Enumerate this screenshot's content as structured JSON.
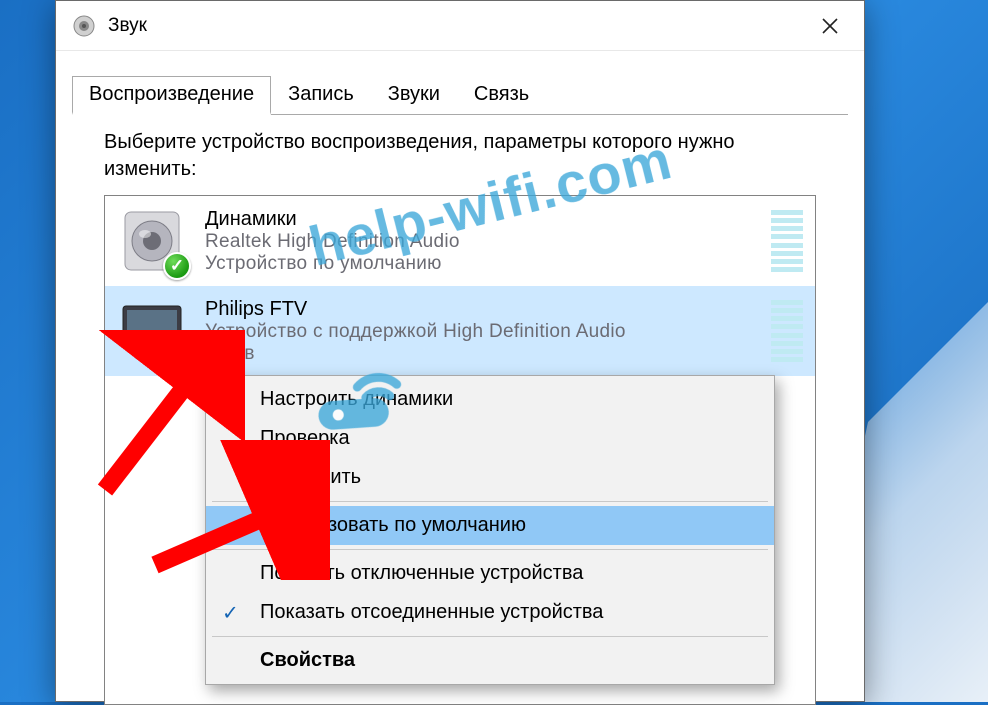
{
  "window": {
    "title": "Звук"
  },
  "tabs": {
    "playback": "Воспроизведение",
    "recording": "Запись",
    "sounds": "Звуки",
    "comm": "Связь"
  },
  "instruction": "Выберите устройство воспроизведения, параметры которого нужно изменить:",
  "devices": [
    {
      "name": "Динамики",
      "driver": "Realtek High Definition Audio",
      "status": "Устройство по умолчанию"
    },
    {
      "name": "Philips FTV",
      "driver": "Устройство с поддержкой High Definition Audio",
      "status": "Готов"
    }
  ],
  "context_menu": {
    "configure": "Настроить динамики",
    "test": "Проверка",
    "disable": "Отключить",
    "set_default": "Использовать по умолчанию",
    "show_disabled": "Показать отключенные устройства",
    "show_disconnected": "Показать отсоединенные устройства",
    "properties": "Свойства"
  },
  "watermark": "help-wifi.com"
}
